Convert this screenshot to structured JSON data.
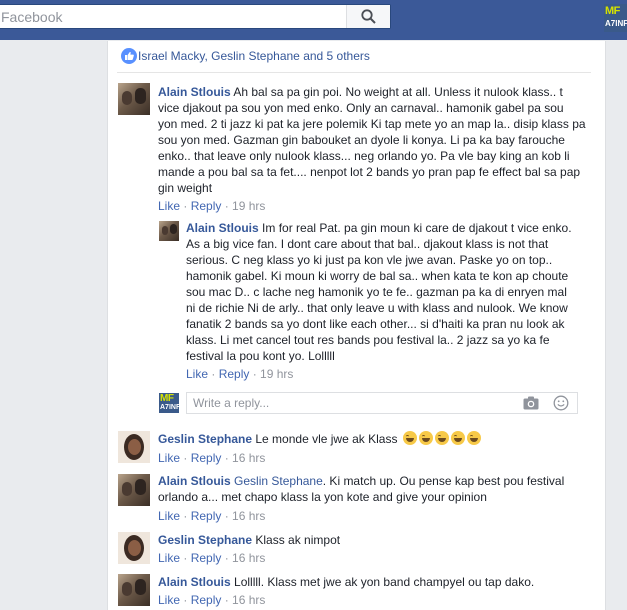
{
  "search": {
    "placeholder": "Facebook"
  },
  "brand": {
    "top": "MF",
    "bottom": "A7INF"
  },
  "likes": {
    "text": "Israel Macky, Geslin Stephane and 5 others"
  },
  "comments": [
    {
      "author": "Alain Stlouis",
      "text": "Ah bal sa pa gin poi. No weight at all. Unless it nulook klass.. t vice djakout pa sou yon med enko. Only an carnaval.. hamonik gabel pa sou yon med. 2 ti jazz ki pat ka jere polemik Ki tap mete yo an map la.. disip klass pa sou yon med. Gazman gin babouket an dyole li konya. Li pa ka bay farouche enko.. that leave only nulook klass... neg orlando yo. Pa vle bay king an kob li mande a pou bal sa ta fet.... nenpot lot 2 bands yo pran pap fe effect bal sa pap gin weight",
      "like": "Like",
      "reply": "Reply",
      "time": "19 hrs"
    },
    {
      "author": "Alain Stlouis",
      "text": "Im for real Pat. pa gin moun ki care de djakout t vice enko. As a big vice fan. I dont care about that bal.. djakout klass is not that serious. C neg klass yo ki just pa kon vle jwe avan. Paske yo on top.. hamonik gabel. Ki moun ki worry de bal sa.. when kata te kon ap choute sou mac D.. c lache neg hamonik yo te fe.. gazman pa ka di enryen mal ni de richie Ni de arly.. that only leave u with klass and nulook. We know fanatik 2 bands sa yo dont like each other... si d'haiti ka pran nu look ak klass. Li met cancel tout res bands pou festival la.. 2 jazz sa yo ka fe festival la pou kont yo. Lolllll",
      "like": "Like",
      "reply": "Reply",
      "time": "19 hrs"
    },
    {
      "author": "Geslin Stephane",
      "text": "Le monde vle jwe ak Klass",
      "emoji_count": 5,
      "like": "Like",
      "reply": "Reply",
      "time": "16 hrs"
    },
    {
      "author": "Alain Stlouis",
      "mention": "Geslin Stephane",
      "text": ". Ki match up. Ou pense kap best pou festival orlando a... met chapo klass la yon kote and give your opinion",
      "like": "Like",
      "reply": "Reply",
      "time": "16 hrs"
    },
    {
      "author": "Geslin Stephane",
      "text": "Klass ak nimpot",
      "like": "Like",
      "reply": "Reply",
      "time": "16 hrs"
    },
    {
      "author": "Alain Stlouis",
      "text": "Lolllll. Klass met jwe ak yon band champyel ou tap dako.",
      "like": "Like",
      "reply": "Reply",
      "time": "16 hrs"
    }
  ],
  "reply_box": {
    "placeholder": "Write a reply..."
  },
  "colors": {
    "topbar": "#3b5998",
    "link": "#365899",
    "meta": "#90949c",
    "action": "#4267b2"
  },
  "icons": [
    "search-icon",
    "like-thumb-icon",
    "camera-icon",
    "emoji-icon",
    "laughing-emoji-icon"
  ]
}
